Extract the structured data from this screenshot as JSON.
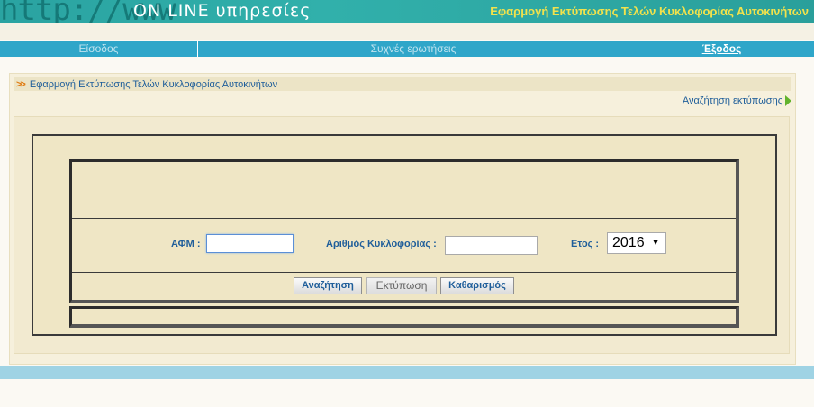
{
  "header": {
    "logo_http": "http://www",
    "logo_online": "ON LINE υπηρεσίες",
    "title": "Εφαρμογή Εκτύπωσης Τελών Κυκλοφορίας Αυτοκινήτων"
  },
  "nav": {
    "home": "Είσοδος",
    "faq": "Συχνές ερωτήσεις",
    "exit": "Έξοδος"
  },
  "breadcrumb": {
    "text": "Εφαρμογή Εκτύπωσης Τελών Κυκλοφορίας Αυτοκινήτων"
  },
  "search_link": "Αναζήτηση εκτύπωσης",
  "form": {
    "afm_label": "ΑΦΜ :",
    "afm_value": "",
    "plate_label": "Αριθμός Κυκλοφορίας :",
    "plate_value": "",
    "year_label": "Ετος :",
    "year_value": "2016"
  },
  "buttons": {
    "search": "Αναζήτηση",
    "print": "Εκτύπωση",
    "clear": "Καθαρισμός"
  },
  "colors": {
    "header_bg": "#2aa3a1",
    "nav_bg": "#2fa6c9",
    "accent_text": "#1f5e9a",
    "title_yellow": "#f2e24c"
  }
}
